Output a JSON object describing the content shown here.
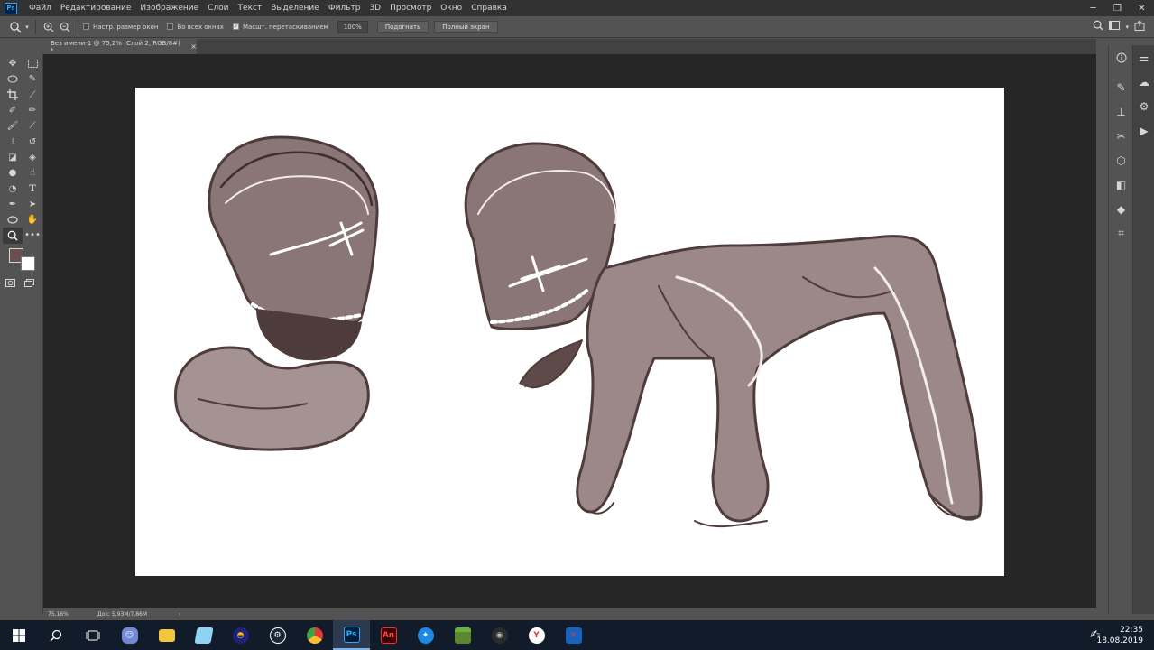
{
  "app": {
    "logo": "Ps"
  },
  "menu": [
    "Файл",
    "Редактирование",
    "Изображение",
    "Слои",
    "Текст",
    "Выделение",
    "Фильтр",
    "3D",
    "Просмотр",
    "Окно",
    "Справка"
  ],
  "window_controls": {
    "minimize": "─",
    "restore": "❐",
    "close": "✕"
  },
  "options": {
    "resize_windows": "Настр. размер окон",
    "all_windows": "Во всех окнах",
    "scrubby_zoom": "Масшт. перетаскиванием",
    "zoom_value": "100%",
    "fit_button": "Подогнать",
    "fullscreen_button": "Полный экран"
  },
  "document": {
    "tab_title": "Без имени-1 @ 75,2% (Слой 2, RGB/8#) *",
    "close": "×"
  },
  "status": {
    "zoom": "75,16%",
    "doc": "Док: 5,93M/7,86M",
    "arrow": "›"
  },
  "colors": {
    "foreground": "#6b4f4f",
    "background": "#ffffff",
    "ink": "#6a5656"
  },
  "taskbar": {
    "photoshop_label": "Ps",
    "animate_label": "An",
    "clock_time": "22:35",
    "clock_date": "18.08.2019"
  }
}
